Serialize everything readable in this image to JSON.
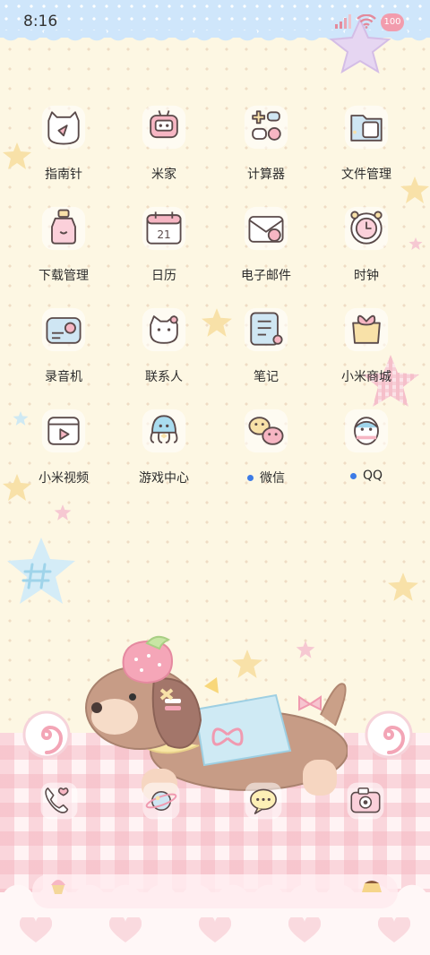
{
  "status_bar": {
    "time": "8:16",
    "battery": "100"
  },
  "apps": [
    {
      "label": "指南针",
      "icon": "compass-cat-icon",
      "notify": false
    },
    {
      "label": "米家",
      "icon": "mijia-robot-icon",
      "notify": false
    },
    {
      "label": "计算器",
      "icon": "calculator-icon",
      "notify": false
    },
    {
      "label": "文件管理",
      "icon": "folder-icon",
      "notify": false
    },
    {
      "label": "下载管理",
      "icon": "download-bottle-icon",
      "notify": false
    },
    {
      "label": "日历",
      "icon": "calendar-icon",
      "notify": false,
      "day": "21"
    },
    {
      "label": "电子邮件",
      "icon": "email-icon",
      "notify": false
    },
    {
      "label": "时钟",
      "icon": "clock-icon",
      "notify": false
    },
    {
      "label": "录音机",
      "icon": "recorder-icon",
      "notify": false
    },
    {
      "label": "联系人",
      "icon": "contacts-cat-icon",
      "notify": false
    },
    {
      "label": "笔记",
      "icon": "notes-icon",
      "notify": false
    },
    {
      "label": "小米商城",
      "icon": "store-bag-icon",
      "notify": false
    },
    {
      "label": "小米视频",
      "icon": "video-player-icon",
      "notify": false
    },
    {
      "label": "游戏中心",
      "icon": "octopus-game-icon",
      "notify": false
    },
    {
      "label": "微信",
      "icon": "wechat-chicks-icon",
      "notify": true
    },
    {
      "label": "QQ",
      "icon": "qq-penguin-icon",
      "notify": true
    }
  ],
  "dock": [
    {
      "icon": "phone-icon"
    },
    {
      "icon": "browser-planet-icon"
    },
    {
      "icon": "messages-bubble-icon"
    },
    {
      "icon": "camera-icon"
    }
  ],
  "colors": {
    "wallpaper": "#fdf7e3",
    "top_band": "#cfe6fb",
    "gingham": "#f4b2be",
    "notify_dot": "#3d7be6"
  }
}
